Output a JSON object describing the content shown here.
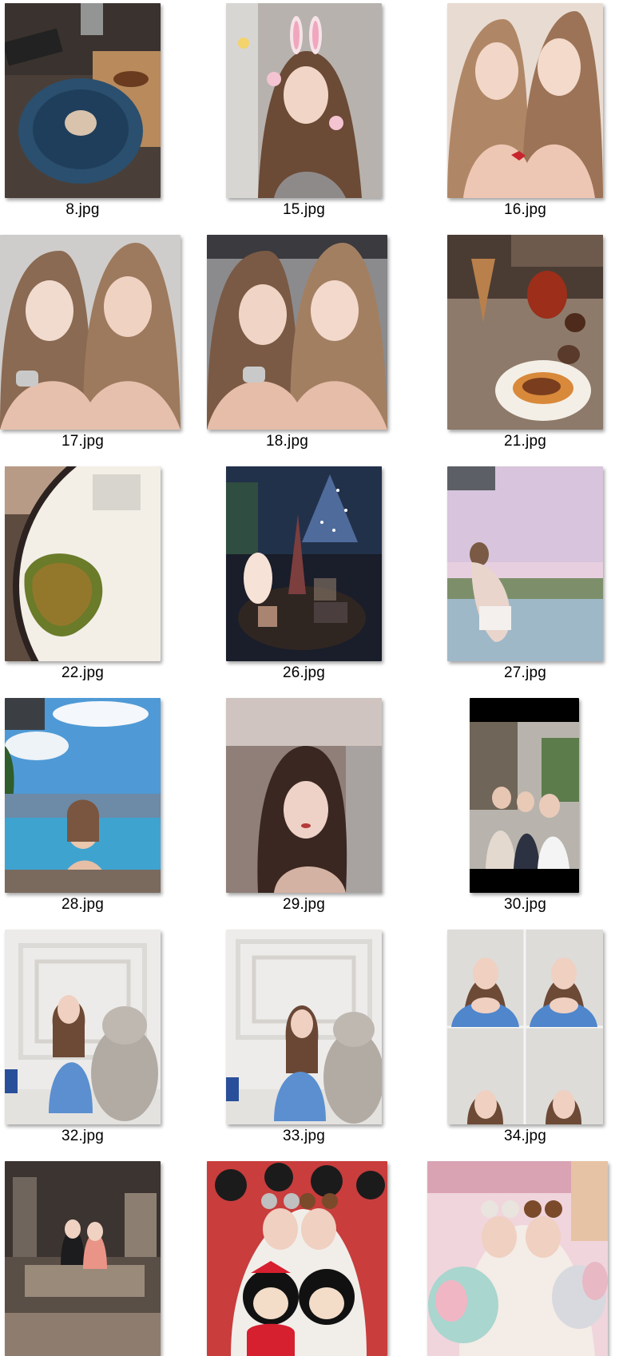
{
  "files": [
    {
      "name": "8.jpg",
      "thumb": "clam-dish-photo"
    },
    {
      "name": "15.jpg",
      "thumb": "bunny-selfie-photo"
    },
    {
      "name": "16.jpg",
      "thumb": "two-women-selfie-photo"
    },
    {
      "name": "17.jpg",
      "thumb": "two-women-selfie-photo"
    },
    {
      "name": "18.jpg",
      "thumb": "two-women-selfie-photo"
    },
    {
      "name": "21.jpg",
      "thumb": "dessert-cocktail-photo"
    },
    {
      "name": "22.jpg",
      "thumb": "plated-dish-photo"
    },
    {
      "name": "26.jpg",
      "thumb": "night-table-lamp-photo"
    },
    {
      "name": "27.jpg",
      "thumb": "infinity-pool-sunset-photo"
    },
    {
      "name": "28.jpg",
      "thumb": "infinity-pool-day-photo"
    },
    {
      "name": "29.jpg",
      "thumb": "portrait-selfie-photo"
    },
    {
      "name": "30.jpg",
      "thumb": "street-group-selfie-photo"
    },
    {
      "name": "32.jpg",
      "thumb": "woman-plush-toy-photo"
    },
    {
      "name": "33.jpg",
      "thumb": "woman-plush-toy-photo"
    },
    {
      "name": "34.jpg",
      "thumb": "photo-booth-strip-photo"
    },
    {
      "name": "",
      "thumb": "lounge-two-women-photo"
    },
    {
      "name": "",
      "thumb": "mickey-minnie-plush-photo"
    },
    {
      "name": "",
      "thumb": "dumbo-plush-photo"
    }
  ]
}
